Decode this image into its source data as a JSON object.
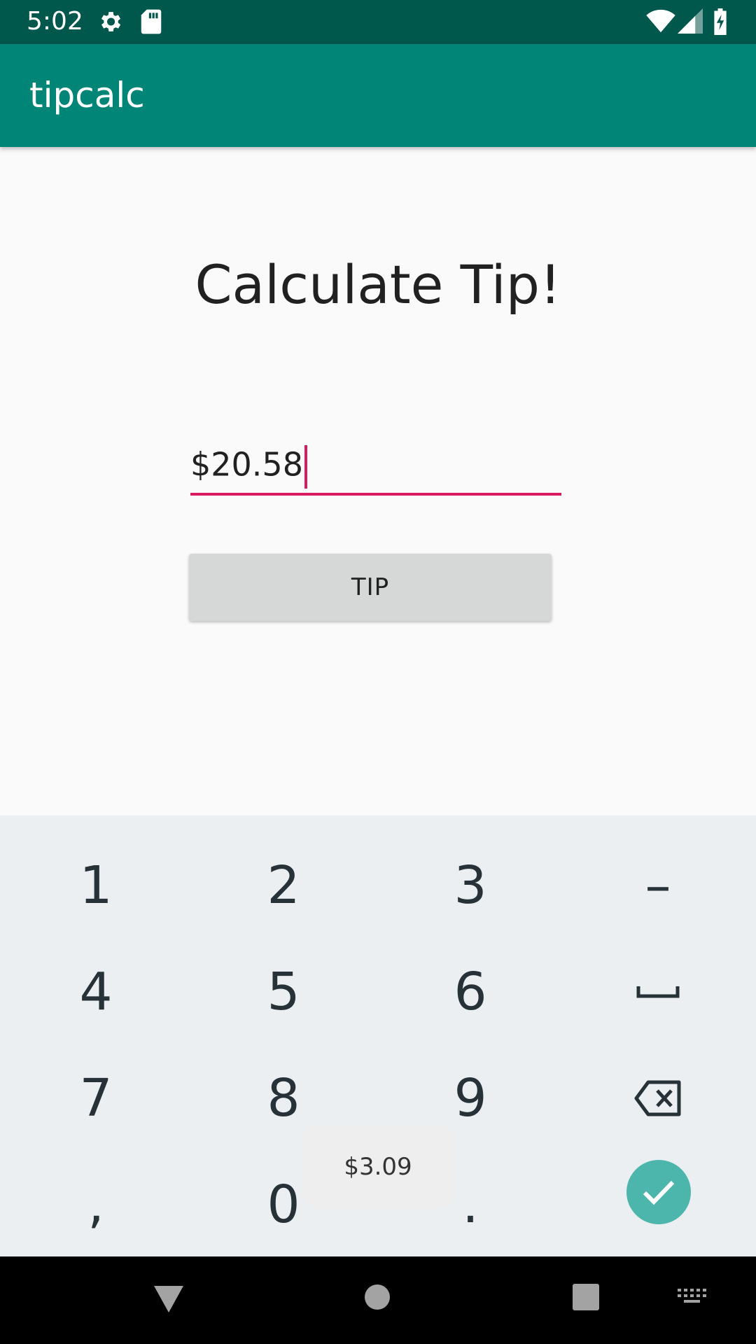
{
  "status_bar": {
    "time": "5:02",
    "icons": [
      "settings-icon",
      "sd-card-icon",
      "wifi-icon",
      "signal-icon",
      "battery-charging-icon"
    ]
  },
  "app_bar": {
    "title": "tipcalc"
  },
  "main": {
    "headline": "Calculate Tip!",
    "amount_value": "$20.58",
    "tip_button_label": "TIP"
  },
  "toast": {
    "text": "$3.09"
  },
  "keyboard": {
    "keys": {
      "k1": "1",
      "k2": "2",
      "k3": "3",
      "minus": "–",
      "k4": "4",
      "k5": "5",
      "k6": "6",
      "k7": "7",
      "k8": "8",
      "k9": "9",
      "comma": ",",
      "k0": "0",
      "period": "."
    },
    "icons": [
      "space-key-icon",
      "backspace-icon",
      "checkmark-icon"
    ]
  },
  "nav_bar": {
    "icons": [
      "back-icon",
      "home-icon",
      "recents-icon",
      "keyboard-switch-icon"
    ]
  },
  "colors": {
    "status_bar": "#00574b",
    "app_bar": "#008577",
    "accent": "#d81b60",
    "keyboard_bg": "#eceff1",
    "done_key": "#4db6ac"
  }
}
